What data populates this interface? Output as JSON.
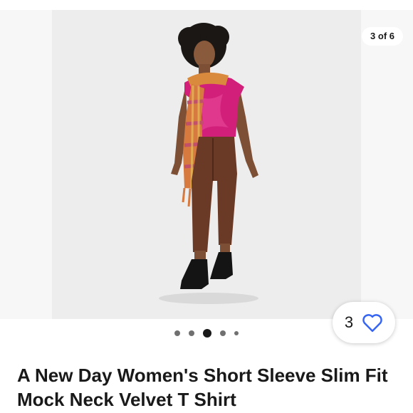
{
  "gallery": {
    "counter": "3 of 6",
    "image_alt": "Model wearing a pink velvet short sleeve top, plaid scarf, brown pants and black loafers",
    "dots": [
      "dot",
      "dot",
      "active-dot",
      "dot",
      "small-dot"
    ]
  },
  "watch": {
    "count": "3",
    "icon": "heart-icon"
  },
  "listing": {
    "title": "A New Day Women's Short Sleeve Slim Fit Mock Neck Velvet T Shirt"
  },
  "colors": {
    "accent": "#3665f3",
    "text": "#191919",
    "dot_inactive": "#707070"
  }
}
